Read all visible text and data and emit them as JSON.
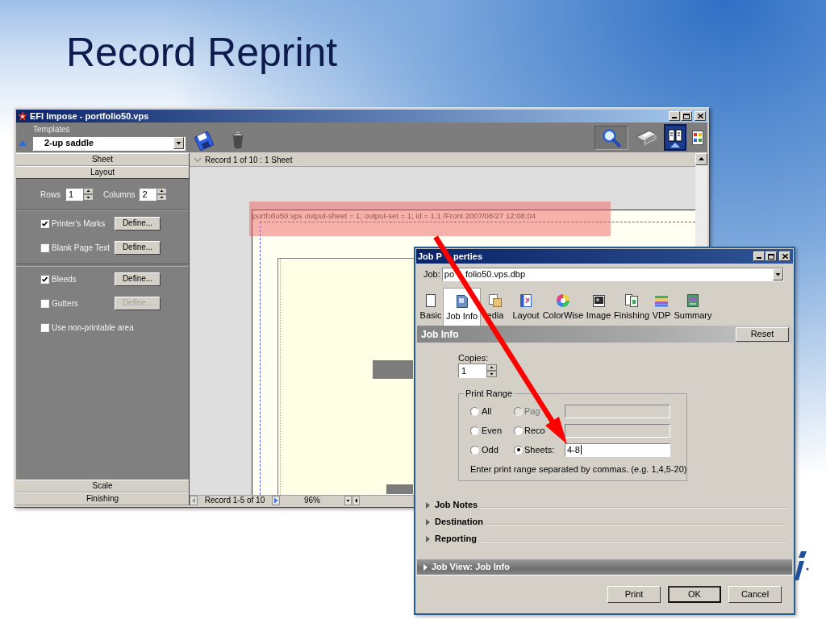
{
  "slide": {
    "title": "Record Reprint"
  },
  "impose_window": {
    "title": "EFI Impose - portfolio50.vps",
    "templates": {
      "label": "Templates",
      "value": "2-up saddle"
    },
    "view_tools": [
      {
        "pressed": true,
        "selected": false
      },
      {
        "pressed": false,
        "selected": false
      },
      {
        "pressed": false,
        "selected": true
      },
      {
        "pressed": false,
        "selected": false
      }
    ],
    "panel_sections": [
      {
        "label": "Sheet",
        "expanded": false
      },
      {
        "label": "Layout",
        "expanded": true
      },
      {
        "label": "Scale",
        "expanded": false
      },
      {
        "label": "Finishing",
        "expanded": false
      }
    ],
    "layout": {
      "rows": {
        "label": "Rows",
        "value": "1"
      },
      "columns": {
        "label": "Columns",
        "value": "2"
      },
      "option_groups": [
        {
          "options": [
            {
              "label": "Printer's Marks",
              "checked": true,
              "button": {
                "label": "Define...",
                "disabled": false
              }
            },
            {
              "label": "Blank Page Text",
              "checked": false,
              "button": {
                "label": "Define...",
                "disabled": false
              }
            }
          ]
        },
        {
          "options": [
            {
              "label": "Bleeds",
              "checked": true,
              "button": {
                "label": "Define...",
                "disabled": false
              }
            },
            {
              "label": "Gutters",
              "checked": false,
              "button": {
                "label": "Define...",
                "disabled": true
              }
            },
            {
              "label": "Use non-printable area",
              "checked": false
            }
          ]
        }
      ]
    },
    "canvas": {
      "header": "Record 1 of 10 : 1 Sheet",
      "sheet_label": "portfolio50.vps output-sheet = 1; output-set = 1; id = 1.1 /Front  2007/08/27 12:08:04"
    },
    "status_bar": {
      "records": "Record 1-5 of 10",
      "zoom": "96%"
    }
  },
  "job_properties": {
    "title": [
      "Job P",
      "perties"
    ],
    "job": {
      "label": "Job:",
      "value": [
        "po",
        "folio50.vps.dbp"
      ]
    },
    "tabs": [
      {
        "label": "Basic",
        "selected": false
      },
      {
        "label": "Job Info",
        "selected": true
      },
      {
        "label": "edia",
        "selected": false
      },
      {
        "label": "Layout",
        "selected": false
      },
      {
        "label": "ColorWise",
        "selected": false
      },
      {
        "label": "Image",
        "selected": false
      },
      {
        "label": "Finishing",
        "selected": false
      },
      {
        "label": "VDP",
        "selected": false
      },
      {
        "label": "Summary",
        "selected": false
      }
    ],
    "section": {
      "title": "Job Info",
      "button": "Reset"
    },
    "copies": {
      "label": "Copies:",
      "value": "1"
    },
    "print_range": {
      "title": "Print Range",
      "subsets": [
        {
          "label": "All",
          "selected": false
        },
        {
          "label": "Even",
          "selected": false
        },
        {
          "label": "Odd",
          "selected": false
        }
      ],
      "ranges": [
        {
          "label": "Pag",
          "selected": false,
          "disabled": true,
          "focused": false
        },
        {
          "label": "Reco",
          "selected": false,
          "disabled": false,
          "focused": false
        },
        {
          "label": "Sheets:",
          "selected": true,
          "disabled": false,
          "focused": true,
          "value": "4-8"
        }
      ],
      "hint": "Enter print range separated by commas. (e.g. 1,4,5-20)"
    },
    "panels": [
      {
        "label": "Job Notes",
        "expanded": false
      },
      {
        "label": "Destination",
        "expanded": false
      },
      {
        "label": "Reporting",
        "expanded": false
      }
    ],
    "job_view": {
      "label": "Job View: Job Info",
      "expanded": false
    },
    "buttons": [
      {
        "label": "Print",
        "default": false
      },
      {
        "label": "OK",
        "default": true
      },
      {
        "label": "Cancel",
        "default": false
      }
    ]
  }
}
